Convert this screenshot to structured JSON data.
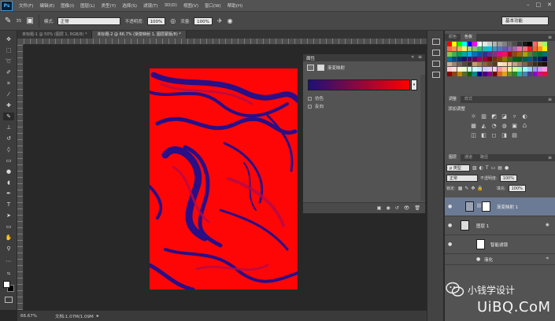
{
  "app": {
    "logo": "Ps"
  },
  "menu": [
    "文件(F)",
    "编辑(E)",
    "图像(I)",
    "图层(L)",
    "类型(Y)",
    "选择(S)",
    "滤镜(T)",
    "3D(D)",
    "视图(V)",
    "窗口(W)",
    "帮助(H)"
  ],
  "window_controls": {
    "minimize": "–",
    "maximize": "□",
    "close": "✕"
  },
  "options": {
    "brush_size": "35",
    "mode_label": "模式:",
    "mode_value": "正常",
    "opacity_label": "不透明度:",
    "opacity_value": "100%",
    "flow_label": "流量:",
    "flow_value": "100%",
    "workspace": "基本功能"
  },
  "doc_tabs": [
    "未标题-1 @ 50% (图层 1, RGB/8) *",
    "未标题-2 @ 66.7% (渐变映射 1, 图层蒙版/8) *"
  ],
  "statusbar": {
    "zoom": "66.67%",
    "doc_info": "文档:1.07M/1.09M",
    "arrow": "▸"
  },
  "properties": {
    "tab": "属性",
    "title": "渐变映射",
    "gradient_colors": [
      "#1c1078",
      "#ff0000"
    ],
    "options": [
      "仿色",
      "反向"
    ],
    "collapse": "«",
    "menu": "≡",
    "dropdown": "▾"
  },
  "right_panels": {
    "swatches_tabs": [
      "颜色",
      "色板"
    ],
    "adjust_tabs": [
      "调整",
      "样式"
    ],
    "adjust_title": "添加调整",
    "adjust_icons": [
      "☼",
      "▥",
      "◩",
      "◪",
      "▿",
      "◐",
      "▦",
      "◭",
      "◔",
      "◍",
      "▣",
      "♺",
      "◫",
      "◧",
      "◻",
      "◨",
      "▤"
    ],
    "layers_tabs": [
      "图层",
      "通道",
      "路径"
    ],
    "filter_label": "ρ 类型",
    "blend_mode": "正常",
    "opacity_label": "不透明度:",
    "opacity_value": "100%",
    "lock_label": "锁定:",
    "fill_label": "填充:",
    "fill_value": "100%",
    "layers": [
      {
        "name": "渐变映射 1",
        "selected": true
      },
      {
        "name": "图层 1",
        "selected": false
      },
      {
        "name": "智能滤镜",
        "selected": false
      },
      {
        "name": "液化",
        "selected": false
      }
    ]
  },
  "watermark": {
    "line1": "小钱学设计",
    "line2": "UiBQ.CoM"
  },
  "swatches": [
    "#ff0000",
    "#ffff00",
    "#00ff00",
    "#00ffff",
    "#0000ff",
    "#ff00ff",
    "#ffffff",
    "#e6e6e6",
    "#cccccc",
    "#b3b3b3",
    "#999999",
    "#808080",
    "#666666",
    "#4d4d4d",
    "#333333",
    "#1a1a1a",
    "#000000",
    "#ff6666",
    "#ffcc66",
    "#99ff66",
    "#f26c4f",
    "#f68e56",
    "#fbaf5c",
    "#fff467",
    "#acd372",
    "#7cc576",
    "#3bb878",
    "#1abbb4",
    "#00bff3",
    "#438ccb",
    "#5574b9",
    "#605ca8",
    "#855fa8",
    "#a763a9",
    "#f06eaa",
    "#f26d7d",
    "#ed1c24",
    "#f26522",
    "#f7941d",
    "#fff200",
    "#8dc63f",
    "#39b54a",
    "#00a651",
    "#00a99d",
    "#00aeef",
    "#0072bc",
    "#0054a6",
    "#2e3192",
    "#662d91",
    "#92278f",
    "#ec008c",
    "#ed145b",
    "#9e0b0f",
    "#a0410d",
    "#a36209",
    "#aba000",
    "#598527",
    "#1a7b30",
    "#007236",
    "#00746b",
    "#0076a3",
    "#004b80",
    "#003471",
    "#1b1464",
    "#440e62",
    "#630460",
    "#9e005d",
    "#9e0039",
    "#790000",
    "#7b2e00",
    "#7d4900",
    "#827b00",
    "#406618",
    "#005e20",
    "#005826",
    "#005952",
    "#005b7f",
    "#003663",
    "#002157",
    "#0d004c",
    "#c7b299",
    "#998675",
    "#736357",
    "#534741",
    "#37302d",
    "#c69c6d",
    "#a67c52",
    "#8c6239",
    "#754c24",
    "#603913",
    "#ffe6cc",
    "#ffd9b3",
    "#e6c8a8",
    "#c4a484",
    "#a0826d",
    "#806452",
    "#5c4033",
    "#3d2b1f",
    "#2a1b12",
    "#1a0f0a",
    "#ffcccc",
    "#ffe0cc",
    "#fff5cc",
    "#e6ffcc",
    "#ccffe6",
    "#ccffff",
    "#cce6ff",
    "#ccccff",
    "#e6ccff",
    "#ffccf2",
    "#ff9999",
    "#ffc299",
    "#ffeb99",
    "#ccff99",
    "#99ffcc",
    "#99ffff",
    "#99ccff",
    "#9999ff",
    "#cc99ff",
    "#ff99e6",
    "#8b0000",
    "#8b4513",
    "#b8860b",
    "#556b2f",
    "#006400",
    "#008b8b",
    "#00008b",
    "#4b0082",
    "#8b008b",
    "#800000",
    "#d2691e",
    "#daa520",
    "#6b8e23",
    "#228b22",
    "#20b2aa",
    "#4682b4",
    "#483d8b",
    "#9400d3",
    "#c71585",
    "#dc143c"
  ]
}
